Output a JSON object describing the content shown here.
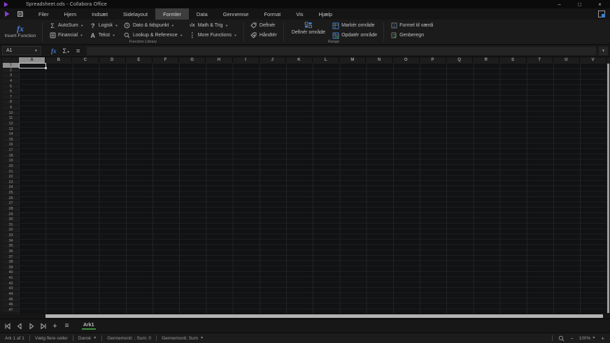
{
  "window": {
    "title": "Spreadsheet.ods - Collabora Office",
    "minimize": "–",
    "maximize": "□",
    "close": "×"
  },
  "menubar": {
    "items": [
      {
        "label": "Filer",
        "active": false
      },
      {
        "label": "Hjem",
        "active": false
      },
      {
        "label": "Indsæt",
        "active": false
      },
      {
        "label": "Sidelayout",
        "active": false
      },
      {
        "label": "Formler",
        "active": true
      },
      {
        "label": "Data",
        "active": false
      },
      {
        "label": "Gennemse",
        "active": false
      },
      {
        "label": "Format",
        "active": false
      },
      {
        "label": "Vis",
        "active": false
      },
      {
        "label": "Hjælp",
        "active": false
      }
    ]
  },
  "ribbon": {
    "insert_function": "Insert Function",
    "autosum": "AutoSum",
    "logisk": "Logisk",
    "dato_tidspunkt": "Dato & tidspunkt",
    "math_trig": "Math & Trig",
    "financial": "Financial",
    "tekst": "Tekst",
    "lookup_reference": "Lookup & Reference",
    "more_functions": "More Functions",
    "definer": "Definér",
    "haandter": "Håndtér",
    "definer_omraade": "Definér område",
    "marker_omraade": "Markér område",
    "opdater_omraade": "Opdatér område",
    "formel_til_vaerdi": "Formel til værdi",
    "genberegn": "Genberegn",
    "function_library_label": "Function Library",
    "range_label": "Range"
  },
  "formula_bar": {
    "cell_ref": "A1",
    "sum_glyph": "Σ",
    "equals_glyph": "=",
    "fx_glyph": "fx"
  },
  "grid": {
    "columns": [
      "A",
      "B",
      "C",
      "D",
      "E",
      "F",
      "G",
      "H",
      "I",
      "J",
      "K",
      "L",
      "M",
      "N",
      "O",
      "P",
      "Q",
      "R",
      "S",
      "T",
      "U",
      "V"
    ],
    "row_count": 47,
    "selected_cell": "A1",
    "selected_column": "A",
    "selected_row": 1
  },
  "sheet_bar": {
    "tabs": [
      {
        "label": "Ark1",
        "active": true
      }
    ]
  },
  "status_bar": {
    "items": [
      {
        "label": "Ark 1 af 1",
        "dropdown": false,
        "interactable": false
      },
      {
        "label": "Vælg flere celler",
        "dropdown": false,
        "interactable": true
      },
      {
        "label": "Dansk",
        "dropdown": true,
        "interactable": true
      },
      {
        "label": "Gennemsnit: ; Sum: 0",
        "dropdown": false,
        "interactable": false
      },
      {
        "label": "Gennemsnit; Sum",
        "dropdown": true,
        "interactable": true
      }
    ],
    "zoom_out": "−",
    "zoom_level": "100%",
    "zoom_in": "+"
  },
  "colors": {
    "accent_blue": "#4a7fd6",
    "accent_green": "#3e8e41",
    "accent_purple": "#8a3fd1",
    "selected_header": "#8f8f8f"
  }
}
